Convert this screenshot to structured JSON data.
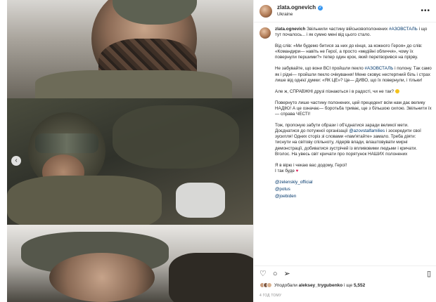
{
  "header": {
    "username": "zlata.ognevich",
    "location": "Ukraine",
    "more_label": "•••"
  },
  "media": {
    "nav_prev": "‹"
  },
  "caption": {
    "username": "zlata.ognevich",
    "intro": "Звільнили частину військовополонених",
    "intro_tag": "#АЗОВСТАЛЬ",
    "intro_end": "і що тут почалось... і як сумно мені від цього стало.",
    "p2": "Від слів: «Ми будемо битися за них до кінця, за кожного Героя» до слів: «Командири— навіть не Герої, а просто «медійні обличчя», чому їх повернули першими?» тепер один крок, який перетворився на прірву.",
    "p3_a": "Не забувайте, що вони ВСІ пройшли пекло",
    "p3_tag": "#АЗОВСТАЛЬ",
    "p3_b": "і полону. Так само як і рідні— пройшли пекло очікування! Мене сковує нестерпний біль і страх лише від однієї думки: «ЯК ЦЕ»? Це— ДИВО, що їх повернули, і тільки!",
    "p4": "Але ж, СПРАВЖНІ друзі пізнаються і в радості, чи не так?",
    "p5": "Повернуто лише частину полонених, цей прецедент всім нам дає велику НАДІЮ! А це означає— боротьба триває, ще з більшою силою. Звільнити їх— справа ЧЕСТІ!",
    "p6_a": "Тож, пропоную забути образи і об'єднатися заради великої мети. Доєднатися до потужної організації",
    "p6_mention": "@azovstalfamilies",
    "p6_b": "і зосередити свої зусилля! Одних сторіз зі словами «пам'ятайте» замало. Треба діяти: тиснути на світову спільноту, лідерів влади, влаштовувати мирні демонстрації, добиватися зустрічей із впливовими людьми і кричати. Вголос. На увесь світ кричати про порятунок НАШИХ полонених",
    "p7_a": "Я в вірю і чекаю вас додому, Герої!",
    "p7_b": "І так буде",
    "mentions": [
      "@zelenskiy_official",
      "@potus",
      "@joebiden"
    ]
  },
  "actions": {
    "like_icon": "heart-outline-icon",
    "comment_icon": "comment-icon",
    "share_icon": "send-icon",
    "save_icon": "bookmark-icon"
  },
  "likes": {
    "prefix": "Уподобали",
    "user": "aleksey_trygubenko",
    "middle": "і ще",
    "count": "5,552"
  },
  "timestamp": "4 ГОД ТОМУ",
  "colors": {
    "link": "#00376b",
    "verified": "#3897f0",
    "muted": "#8e8e8e"
  }
}
